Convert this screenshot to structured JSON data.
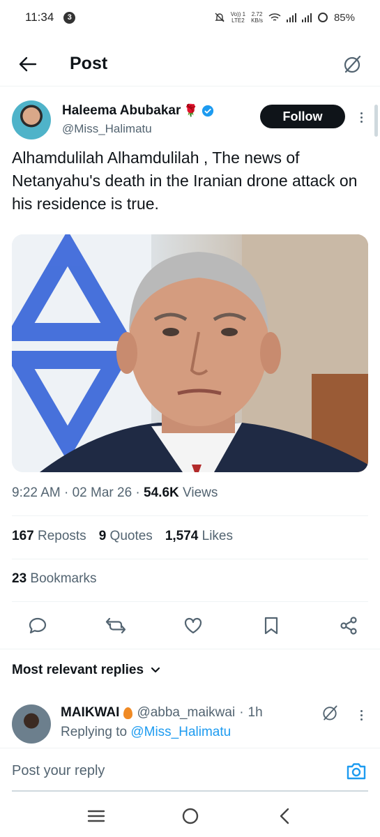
{
  "status_bar": {
    "time": "11:34",
    "notification_count": "3",
    "network_label": "Vo) LTE2",
    "network_line1": "Vo)) 1",
    "network_line2": "LTE2",
    "speed_value": "2.72",
    "speed_unit": "KB/s",
    "battery": "85%"
  },
  "header": {
    "title": "Post"
  },
  "post": {
    "author_name": "Haleema Abubakar",
    "author_handle": "@Miss_Halimatu",
    "follow_label": "Follow",
    "text": "Alhamdulilah Alhamdulilah , The news of Netanyahu's death in the Iranian drone attack on his residence is true.",
    "time": "9:22 AM",
    "date": "02 Mar 26",
    "views_count": "54.6K",
    "views_label": "Views",
    "reposts_count": "167",
    "reposts_label": "Reposts",
    "quotes_count": "9",
    "quotes_label": "Quotes",
    "likes_count": "1,574",
    "likes_label": "Likes",
    "bookmarks_count": "23",
    "bookmarks_label": "Bookmarks"
  },
  "replies": {
    "sort_label": "Most relevant replies",
    "items": [
      {
        "name": "MAIKWAI",
        "handle": "@abba_maikwai",
        "age": "1h",
        "replying_prefix": "Replying to",
        "replying_handle": "@Miss_Halimatu"
      }
    ]
  },
  "composer": {
    "placeholder": "Post your reply"
  },
  "colors": {
    "accent": "#1d9bf0",
    "text_primary": "#0f1419",
    "text_secondary": "#536471",
    "follow_bg": "#0f1419",
    "border": "#eff3f4"
  }
}
